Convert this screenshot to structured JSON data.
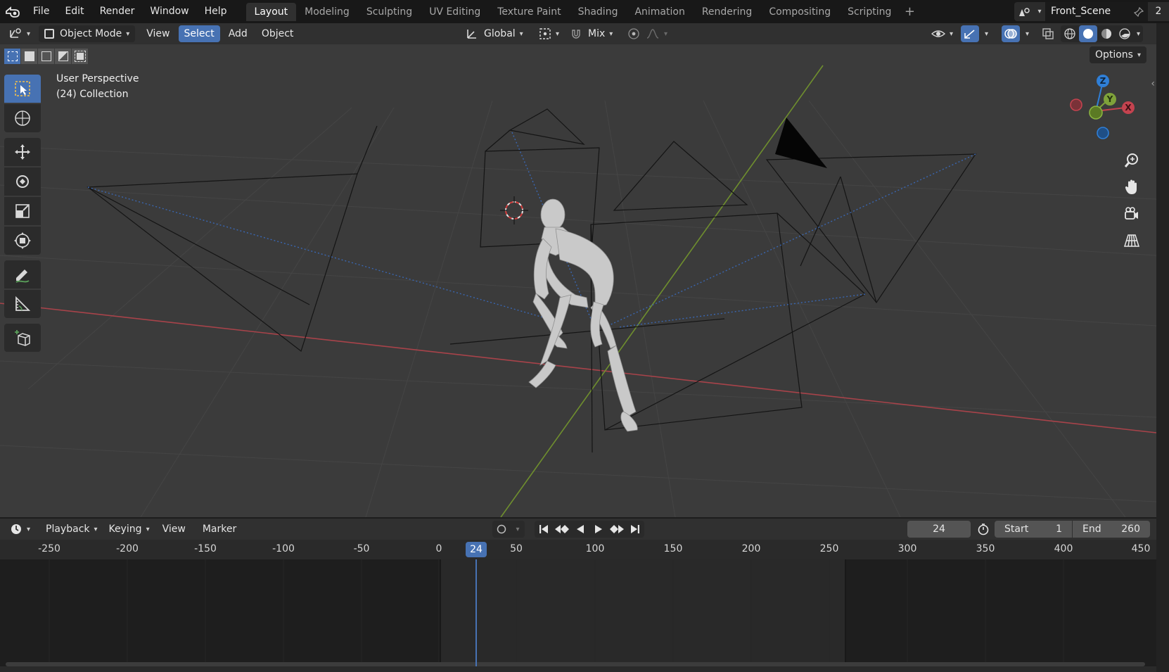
{
  "menu": [
    "File",
    "Edit",
    "Render",
    "Window",
    "Help"
  ],
  "workspaces": [
    {
      "label": "Layout",
      "active": true
    },
    {
      "label": "Modeling"
    },
    {
      "label": "Sculpting"
    },
    {
      "label": "UV Editing"
    },
    {
      "label": "Texture Paint"
    },
    {
      "label": "Shading"
    },
    {
      "label": "Animation"
    },
    {
      "label": "Rendering"
    },
    {
      "label": "Compositing"
    },
    {
      "label": "Scripting"
    }
  ],
  "scene": {
    "name": "Front_Scene",
    "number": "2"
  },
  "viewport": {
    "mode": "Object Mode",
    "menus": {
      "view": "View",
      "select": "Select",
      "add": "Add",
      "object": "Object"
    },
    "transform_orientation": "Global",
    "snap_mode": "Mix",
    "options": "Options",
    "info_line1": "User Perspective",
    "info_line2": "(24) Collection"
  },
  "gizmo": {
    "x": "X",
    "y": "Y",
    "z": "Z"
  },
  "timeline": {
    "menus": {
      "playback": "Playback",
      "keying": "Keying",
      "view": "View",
      "marker": "Marker"
    },
    "current_frame": "24",
    "start_label": "Start",
    "start_value": "1",
    "end_label": "End",
    "end_value": "260",
    "ticks": [
      "-250",
      "-200",
      "-150",
      "-100",
      "-50",
      "0",
      "50",
      "100",
      "150",
      "200",
      "250",
      "300",
      "350",
      "400",
      "450"
    ]
  },
  "colors": {
    "accent": "#4772b3",
    "x_axis": "#c4434f",
    "y_axis": "#7fa23a",
    "z_axis": "#2f7fd7"
  }
}
